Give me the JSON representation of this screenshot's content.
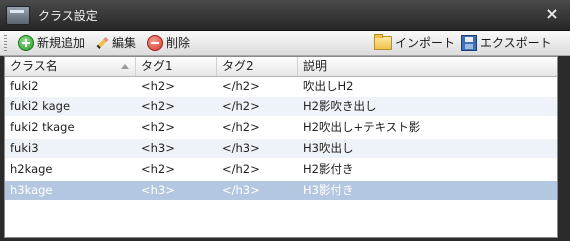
{
  "window": {
    "title": "クラス設定",
    "close_glyph": "×"
  },
  "toolbar": {
    "new_label": "新規追加",
    "edit_label": "編集",
    "delete_label": "削除",
    "import_label": "インポート",
    "export_label": "エクスポート"
  },
  "table": {
    "headers": [
      "クラス名",
      "タグ1",
      "タグ2",
      "説明"
    ],
    "rows": [
      [
        "fuki2",
        "<h2>",
        "</h2>",
        "吹出しH2"
      ],
      [
        "fuki2 kage",
        "<h2>",
        "</h2>",
        "H2影吹き出し"
      ],
      [
        "fuki2 tkage",
        "<h2>",
        "</h2>",
        "H2吹出し+テキスト影"
      ],
      [
        "fuki3",
        "<h3>",
        "</h3>",
        "H3吹出し"
      ],
      [
        "h2kage",
        "<h2>",
        "</h2>",
        "H2影付き"
      ],
      [
        "h3kage",
        "<h3>",
        "</h3>",
        "H3影付き"
      ]
    ],
    "selected_row": 5
  },
  "colors": {
    "row_alt": "#eef3f9",
    "row_selected": "#b4c7e0"
  }
}
